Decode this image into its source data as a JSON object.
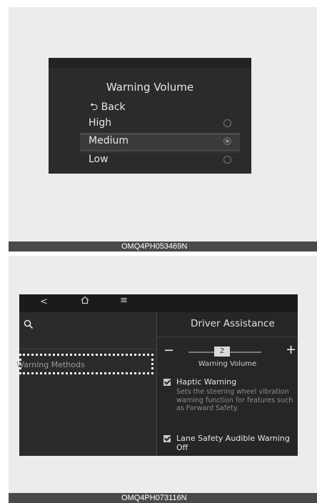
{
  "screen1": {
    "title": "Warning Volume",
    "back_label": "Back",
    "options": [
      {
        "label": "High",
        "selected": false
      },
      {
        "label": "Medium",
        "selected": true
      },
      {
        "label": "Low",
        "selected": false
      }
    ],
    "caption": "OMQ4PH053469N"
  },
  "screen2": {
    "topbar": {
      "back_icon": "chevron-left-icon",
      "home_icon": "home-icon",
      "menu_icon": "menu-icon"
    },
    "left": {
      "search_icon": "search-icon",
      "menu_item": "Warning Methods"
    },
    "right": {
      "title": "Driver Assistance",
      "volume": {
        "value": "2",
        "label": "Warning Volume",
        "minus": "−",
        "plus": "+"
      },
      "haptic": {
        "title": "Haptic Warning",
        "description": "Sets the steering wheel vibration warning function for features such as Forward Safety.",
        "checked": true
      },
      "lane": {
        "title": "Lane Safety Audible Warning Off",
        "checked": true
      }
    },
    "caption": "OMQ4PH073116N"
  },
  "colors": {
    "screen_bg": "#262626",
    "panel_bg": "#ececec",
    "caption_bar": "#4a4a4a"
  }
}
